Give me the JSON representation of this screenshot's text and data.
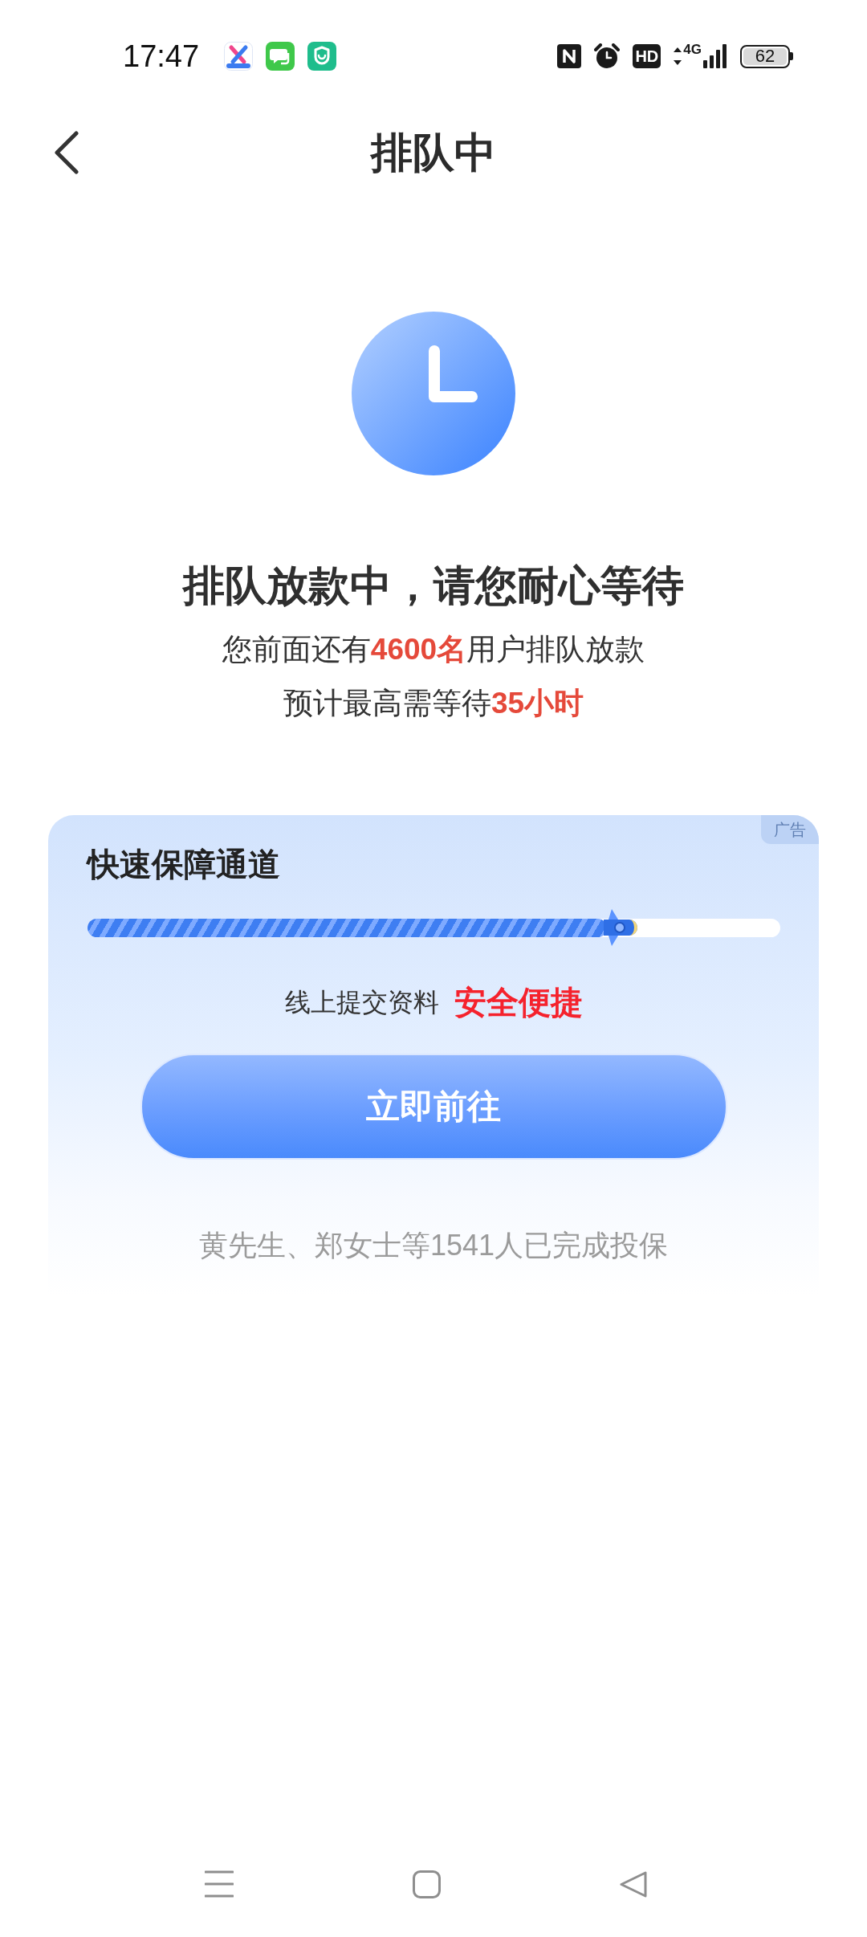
{
  "status_bar": {
    "time": "17:47",
    "hd_label": "HD",
    "network_type": "4G",
    "battery": "62"
  },
  "header": {
    "title": "排队中"
  },
  "queue_status": {
    "headline": "排队放款中，请您耐心等待",
    "lines": [
      {
        "before": "您前面还有",
        "highlight": "4600名",
        "after": "用户排队放款"
      },
      {
        "before": "预计最高需等待",
        "highlight": "35小时"
      }
    ]
  },
  "promo_card": {
    "ad_label": "广告",
    "title": "快速保障通道",
    "progress": {
      "level": 0.75
    },
    "tagline": "线上提交资料",
    "tagline_highlight": "安全便捷",
    "button": "立即前往",
    "ticker": [
      "黄先生、郑女士等1541人已完成投保"
    ]
  }
}
